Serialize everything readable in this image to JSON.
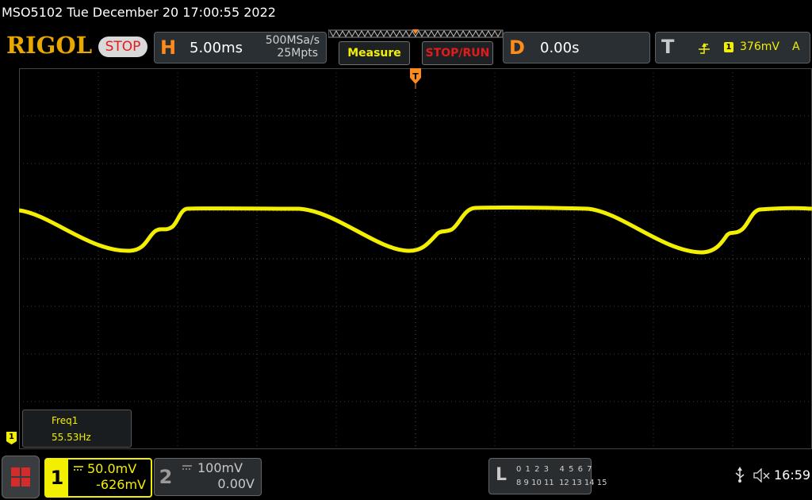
{
  "header": {
    "title": "MSO5102  Tue December 20 17:00:55 2022",
    "logo": "RIGOL",
    "run_state": "STOP"
  },
  "horizontal": {
    "letter": "H",
    "timebase": "5.00ms",
    "sample_rate": "500MSa/s",
    "memory_depth": "25Mpts"
  },
  "buttons": {
    "measure": "Measure",
    "stop_run": "STOP/RUN"
  },
  "delay": {
    "letter": "D",
    "value": "0.00s"
  },
  "trigger": {
    "letter": "T",
    "channel": "1",
    "level": "376mV",
    "mode": "A"
  },
  "trigger_marker": "T",
  "measurement": {
    "name": "Freq1",
    "value": "55.53Hz"
  },
  "channel_marker": "1",
  "channel1": {
    "number": "1",
    "scale": "50.0mV",
    "offset": "-626mV"
  },
  "channel2": {
    "number": "2",
    "scale": "100mV",
    "offset": "0.00V"
  },
  "logic": {
    "letter": "L",
    "row1": "0 1 2 3   4 5 6 7",
    "row2": "8 9 10 11  12 13 14 15"
  },
  "status": {
    "time": "16:59"
  },
  "colors": {
    "channel1": "#f2ef00",
    "accent": "#ff8c1a",
    "grid": "#3b3b3b"
  }
}
